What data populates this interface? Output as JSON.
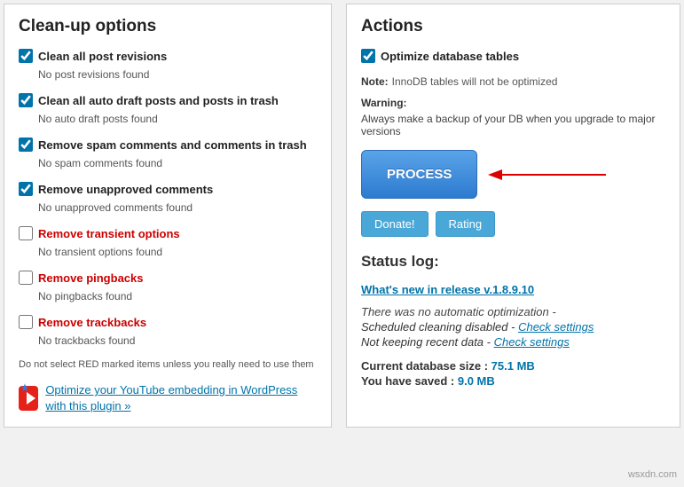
{
  "left": {
    "title": "Clean-up options",
    "opts": [
      {
        "label": "Clean all post revisions",
        "status": "No post revisions found",
        "checked": true,
        "red": false
      },
      {
        "label": "Clean all auto draft posts and posts in trash",
        "status": "No auto draft posts found",
        "checked": true,
        "red": false
      },
      {
        "label": "Remove spam comments and comments in trash",
        "status": "No spam comments found",
        "checked": true,
        "red": false
      },
      {
        "label": "Remove unapproved comments",
        "status": "No unapproved comments found",
        "checked": true,
        "red": false
      },
      {
        "label": "Remove transient options",
        "status": "No transient options found",
        "checked": false,
        "red": true
      },
      {
        "label": "Remove pingbacks",
        "status": "No pingbacks found",
        "checked": false,
        "red": true
      },
      {
        "label": "Remove trackbacks",
        "status": "No trackbacks found",
        "checked": false,
        "red": true
      }
    ],
    "footnote": "Do not select RED marked items unless you really need to use them",
    "promo": "Optimize your YouTube embedding in WordPress with this plugin »"
  },
  "right": {
    "title": "Actions",
    "checkbox_label": "Optimize database tables",
    "note_label": "Note:",
    "note_text": "InnoDB tables will not be optimized",
    "warning_label": "Warning:",
    "warning_text": "Always make a backup of your DB when you upgrade to major versions",
    "process": "PROCESS",
    "donate": "Donate!",
    "rating": "Rating",
    "status_title": "Status log:",
    "release_link": "What's new in release v.1.8.9.10",
    "italic_line": "There was no automatic optimization -",
    "sched_line_pre": "Scheduled cleaning disabled - ",
    "sched_link": "Check settings",
    "keep_line_pre": "Not keeping recent data - ",
    "keep_link": "Check settings",
    "db_size_label": "Current database size : ",
    "db_size_val": "75.1 MB",
    "saved_label": "You have saved : ",
    "saved_val": "9.0 MB"
  },
  "watermark": "wsxdn.com"
}
